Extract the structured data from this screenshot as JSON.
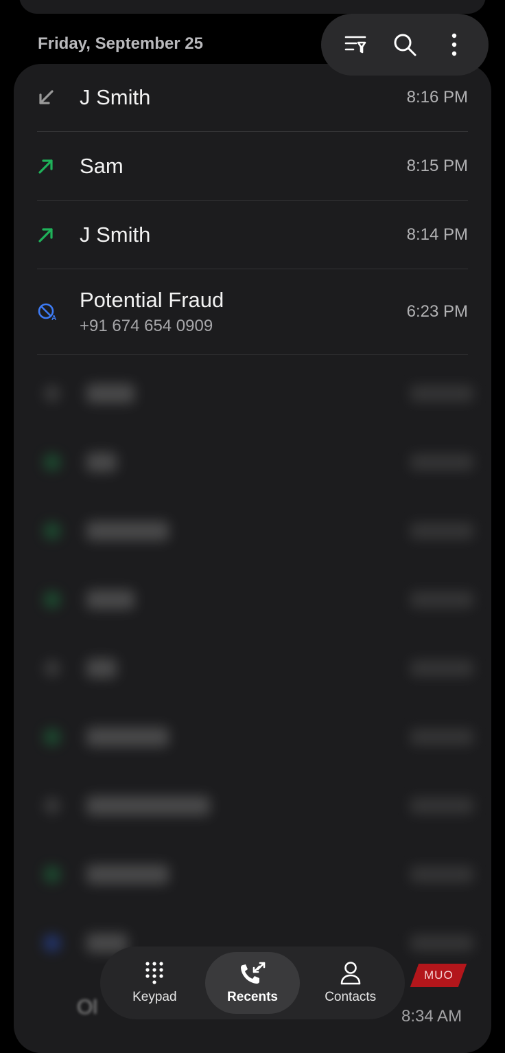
{
  "header": {
    "date": "Friday, September 25"
  },
  "toolbar": {
    "icons": [
      "filter-icon",
      "search-icon",
      "more-options-icon"
    ]
  },
  "calls": [
    {
      "name": "J Smith",
      "number": "",
      "time": "8:16 PM",
      "direction": "incoming",
      "color": "#9a9a9a"
    },
    {
      "name": "Sam",
      "number": "",
      "time": "8:15 PM",
      "direction": "outgoing",
      "color": "#1fb25a"
    },
    {
      "name": "J Smith",
      "number": "",
      "time": "8:14 PM",
      "direction": "outgoing",
      "color": "#1fb25a"
    },
    {
      "name": "Potential Fraud",
      "number": "+91 674 654 0909",
      "time": "6:23 PM",
      "direction": "blocked-fraud",
      "color": "#3d7bf5"
    }
  ],
  "peek_row": {
    "name": "Ol",
    "time": "8:34 AM"
  },
  "nav": {
    "items": [
      {
        "label": "Keypad",
        "icon": "keypad-icon",
        "active": false
      },
      {
        "label": "Recents",
        "icon": "recents-icon",
        "active": true
      },
      {
        "label": "Contacts",
        "icon": "contacts-icon",
        "active": false
      }
    ]
  },
  "watermark": {
    "text": "MUO"
  }
}
